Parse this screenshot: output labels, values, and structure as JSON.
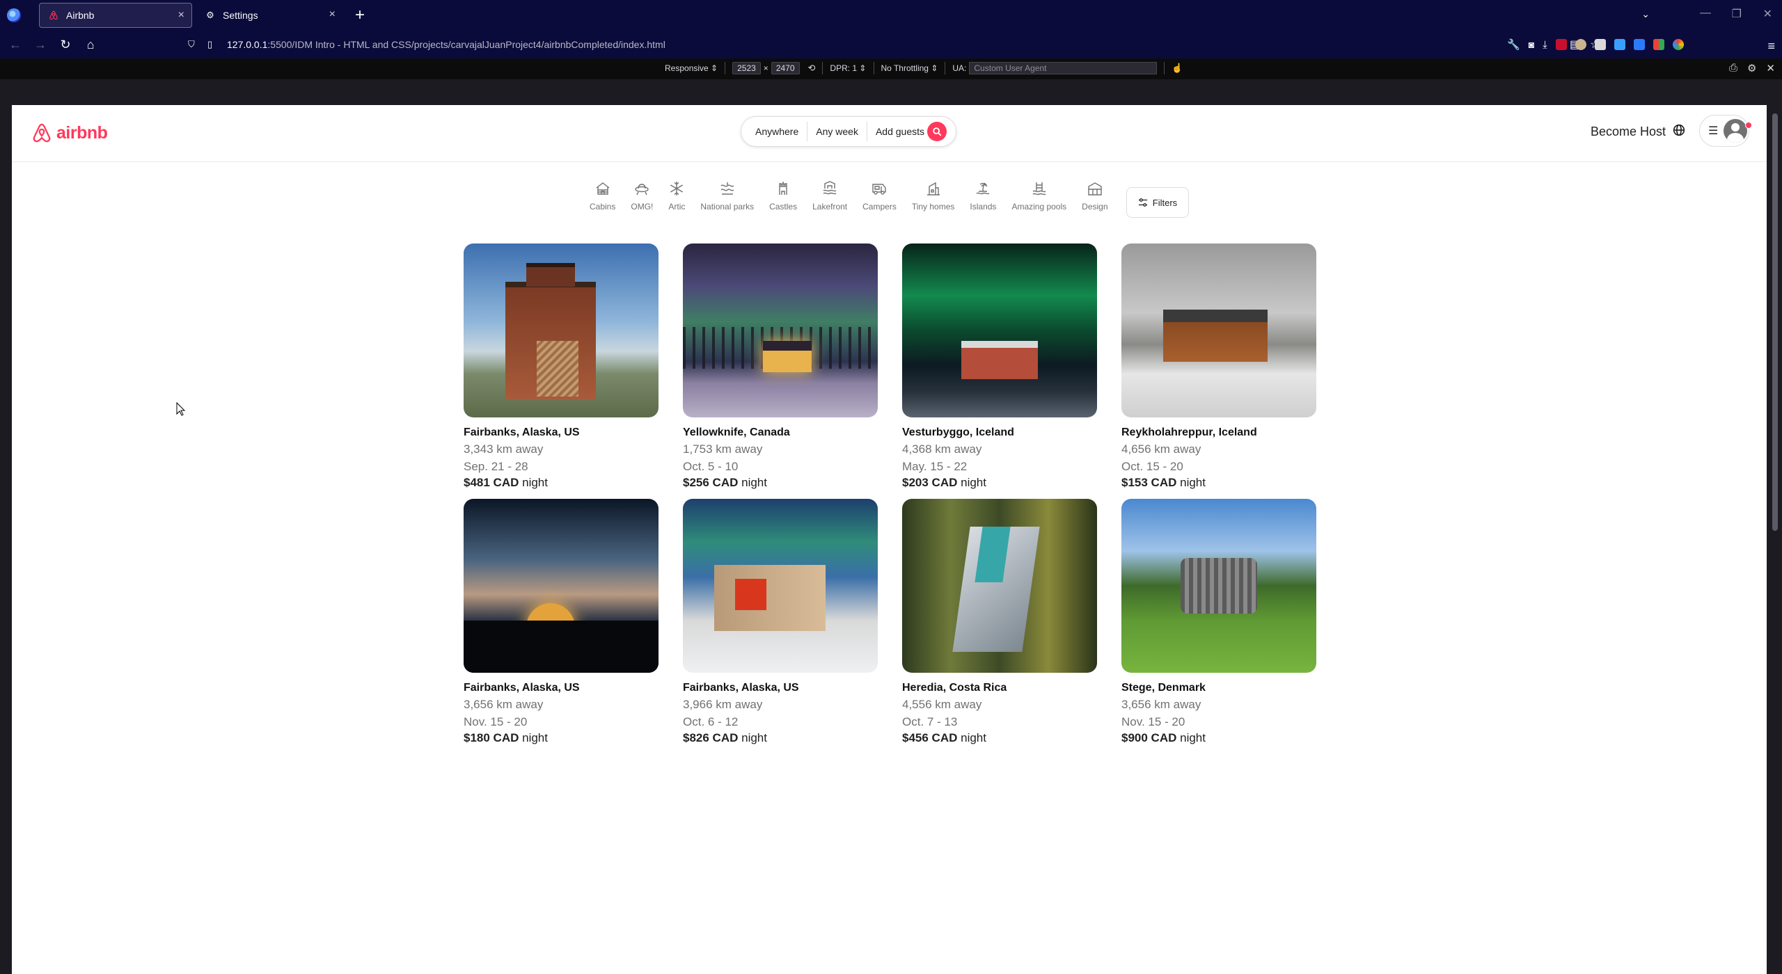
{
  "browser": {
    "tabs": [
      {
        "title": "Airbnb",
        "active": true
      },
      {
        "title": "Settings",
        "active": false
      }
    ],
    "url": {
      "host": "127.0.0.1",
      "path": ":5500/IDM Intro - HTML and CSS/projects/carvajalJuanProject4/airbnbCompleted/index.html"
    },
    "responsive_toolbar": {
      "device": "Responsive ⇕",
      "width": "2523",
      "height": "2470",
      "dpr": "DPR: 1 ⇕",
      "throttling": "No Throttling ⇕",
      "ua_label": "UA:",
      "ua_placeholder": "Custom User Agent"
    }
  },
  "site": {
    "brand": "airbnb",
    "brand_color": "#ff385c",
    "search": {
      "where": "Anywhere",
      "when": "Any week",
      "who": "Add guests"
    },
    "host_link": "Become Host",
    "categories": [
      "Cabins",
      "OMG!",
      "Artic",
      "National parks",
      "Castles",
      "Lakefront",
      "Campers",
      "Tiny homes",
      "Islands",
      "Amazing pools",
      "Design"
    ],
    "filters_label": "Filters",
    "listings": [
      {
        "location": "Fairbanks, Alaska, US",
        "distance": "3,343 km away",
        "dates": "Sep. 21 - 28",
        "price": "$481 CAD",
        "unit": "night"
      },
      {
        "location": "Yellowknife, Canada",
        "distance": "1,753 km away",
        "dates": "Oct. 5 - 10",
        "price": "$256 CAD",
        "unit": "night"
      },
      {
        "location": "Vesturbyggo, Iceland",
        "distance": "4,368 km away",
        "dates": "May. 15 - 22",
        "price": "$203 CAD",
        "unit": "night"
      },
      {
        "location": "Reykholahreppur, Iceland",
        "distance": "4,656 km away",
        "dates": "Oct. 15 - 20",
        "price": "$153 CAD",
        "unit": "night"
      },
      {
        "location": "Fairbanks, Alaska, US",
        "distance": "3,656 km away",
        "dates": "Nov. 15 - 20",
        "price": "$180 CAD",
        "unit": "night"
      },
      {
        "location": "Fairbanks, Alaska, US",
        "distance": "3,966 km away",
        "dates": "Oct. 6 - 12",
        "price": "$826 CAD",
        "unit": "night"
      },
      {
        "location": "Heredia, Costa Rica",
        "distance": "4,556 km away",
        "dates": "Oct. 7 - 13",
        "price": "$456 CAD",
        "unit": "night"
      },
      {
        "location": "Stege, Denmark",
        "distance": "3,656 km away",
        "dates": "Nov. 15 - 20",
        "price": "$900 CAD",
        "unit": "night"
      }
    ]
  }
}
